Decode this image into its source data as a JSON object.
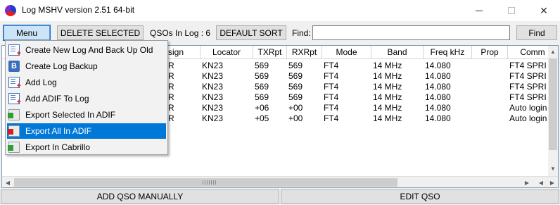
{
  "window": {
    "title": "Log MSHV version 2.51 64-bit",
    "close_glyph": "✕"
  },
  "toolbar": {
    "menu_label": "Menu",
    "delete_label": "DELETE SELECTED",
    "qsos_label": "QSOs In Log : 6",
    "default_sort_label": "DEFAULT SORT",
    "find_label": "Find:",
    "find_value": "",
    "find_button_label": "Find"
  },
  "table": {
    "columns": [
      "",
      "sign",
      "Locator",
      "TXRpt",
      "RXRpt",
      "Mode",
      "Band",
      "Freq kHz",
      "Prop",
      "Comm"
    ],
    "rows": [
      {
        "call": "R",
        "locator": "KN23",
        "txrpt": "569",
        "rxrpt": "569",
        "mode": "FT4",
        "band": "14 MHz",
        "freq": "14.080",
        "prop": "",
        "comment": "FT4 SPRI"
      },
      {
        "call": "R",
        "locator": "KN23",
        "txrpt": "569",
        "rxrpt": "569",
        "mode": "FT4",
        "band": "14 MHz",
        "freq": "14.080",
        "prop": "",
        "comment": "FT4 SPRI"
      },
      {
        "call": "R",
        "locator": "KN23",
        "txrpt": "569",
        "rxrpt": "569",
        "mode": "FT4",
        "band": "14 MHz",
        "freq": "14.080",
        "prop": "",
        "comment": "FT4 SPRI"
      },
      {
        "call": "R",
        "locator": "KN23",
        "txrpt": "569",
        "rxrpt": "569",
        "mode": "FT4",
        "band": "14 MHz",
        "freq": "14.080",
        "prop": "",
        "comment": "FT4 SPRI"
      },
      {
        "call": "R",
        "locator": "KN23",
        "txrpt": "+06",
        "rxrpt": "+00",
        "mode": "FT4",
        "band": "14 MHz",
        "freq": "14.080",
        "prop": "",
        "comment": "Auto login"
      },
      {
        "call": "R",
        "locator": "KN23",
        "txrpt": "+05",
        "rxrpt": "+00",
        "mode": "FT4",
        "band": "14 MHz",
        "freq": "14.080",
        "prop": "",
        "comment": "Auto login"
      }
    ]
  },
  "menu": {
    "items": [
      {
        "label": "Create New Log  And Back Up Old",
        "icon": "new-log-icon"
      },
      {
        "label": "Create Log Backup",
        "icon": "backup-icon"
      },
      {
        "label": "Add Log",
        "icon": "add-log-icon"
      },
      {
        "label": "Add ADIF To Log",
        "icon": "add-adif-icon"
      },
      {
        "label": "Export Selected In ADIF",
        "icon": "export-icon"
      },
      {
        "label": "Export All In ADIF",
        "icon": "export-icon"
      },
      {
        "label": "Export In Cabrillo",
        "icon": "export-icon"
      }
    ],
    "backup_icon_letter": "B",
    "selected_index": 5
  },
  "bottom": {
    "add_label": "ADD QSO MANUALLY",
    "edit_label": "EDIT QSO"
  },
  "colors": {
    "selection": "#0078d7",
    "menu_button_bg": "#cce4f7"
  }
}
